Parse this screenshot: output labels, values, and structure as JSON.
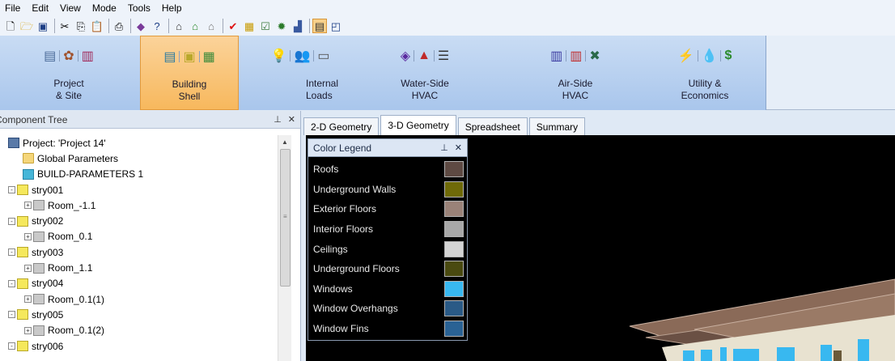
{
  "menu": [
    "File",
    "Edit",
    "View",
    "Mode",
    "Tools",
    "Help"
  ],
  "toolbar_icons": [
    "new-icon",
    "open-icon",
    "save-icon",
    "cut-icon",
    "copy-icon",
    "paste-icon",
    "print-icon",
    "wizard-icon",
    "help-icon",
    "building-icon",
    "building-add-icon",
    "building-outline-icon",
    "check-icon",
    "table-icon",
    "report-icon",
    "sun-icon",
    "chart-icon",
    "view-toggle-icon",
    "window-icon"
  ],
  "ribbon": {
    "groups": [
      {
        "label1": "Project",
        "label2": "& Site",
        "active": false
      },
      {
        "label1": "Building",
        "label2": "Shell",
        "active": true
      },
      {
        "label1": "Internal",
        "label2": "Loads",
        "active": false
      },
      {
        "label1": "Water-Side",
        "label2": "HVAC",
        "active": false
      },
      {
        "label1": "Air-Side",
        "label2": "HVAC",
        "active": false
      },
      {
        "label1": "Utility &",
        "label2": "Economics",
        "active": false
      }
    ]
  },
  "component_tree": {
    "title": "Component Tree",
    "pin": "p",
    "close": "×",
    "items": [
      {
        "label": "Project:  'Project 14'",
        "type": "project",
        "indent": 0,
        "expander": ""
      },
      {
        "label": "Global Parameters",
        "type": "folder",
        "indent": 1,
        "expander": ""
      },
      {
        "label": "BUILD-PARAMETERS 1",
        "type": "building",
        "indent": 1,
        "expander": ""
      },
      {
        "label": "stry001",
        "type": "story",
        "indent": 0,
        "expander": "-"
      },
      {
        "label": "Room_-1.1",
        "type": "room",
        "indent": 1,
        "expander": "+"
      },
      {
        "label": "stry002",
        "type": "story",
        "indent": 0,
        "expander": "-"
      },
      {
        "label": "Room_0.1",
        "type": "room",
        "indent": 1,
        "expander": "+"
      },
      {
        "label": "stry003",
        "type": "story",
        "indent": 0,
        "expander": "-"
      },
      {
        "label": "Room_1.1",
        "type": "room",
        "indent": 1,
        "expander": "+"
      },
      {
        "label": "stry004",
        "type": "story",
        "indent": 0,
        "expander": "-"
      },
      {
        "label": "Room_0.1(1)",
        "type": "room",
        "indent": 1,
        "expander": "+"
      },
      {
        "label": "stry005",
        "type": "story",
        "indent": 0,
        "expander": "-"
      },
      {
        "label": "Room_0.1(2)",
        "type": "room",
        "indent": 1,
        "expander": "+"
      },
      {
        "label": "stry006",
        "type": "story",
        "indent": 0,
        "expander": "-"
      }
    ]
  },
  "tabs": [
    "2-D Geometry",
    "3-D Geometry",
    "Spreadsheet",
    "Summary"
  ],
  "active_tab": "3-D Geometry",
  "legend": {
    "title": "Color Legend",
    "items": [
      {
        "label": "Roofs",
        "color": "#5e4a43"
      },
      {
        "label": "Underground Walls",
        "color": "#6f6a08"
      },
      {
        "label": "Exterior Floors",
        "color": "#9a8278"
      },
      {
        "label": "Interior Floors",
        "color": "#a8a8a8"
      },
      {
        "label": "Ceilings",
        "color": "#d4d4d4"
      },
      {
        "label": "Underground Floors",
        "color": "#4a4a10"
      },
      {
        "label": "Windows",
        "color": "#38b8f0"
      },
      {
        "label": "Window Overhangs",
        "color": "#2a5a86"
      },
      {
        "label": "Window Fins",
        "color": "#2a6294"
      }
    ]
  },
  "colors": {
    "ribbon_active": "#f7b85d",
    "viewport_bg": "#000000",
    "roof": "#8a6a5a",
    "wall": "#e8e0cc",
    "window": "#38b8f0"
  }
}
